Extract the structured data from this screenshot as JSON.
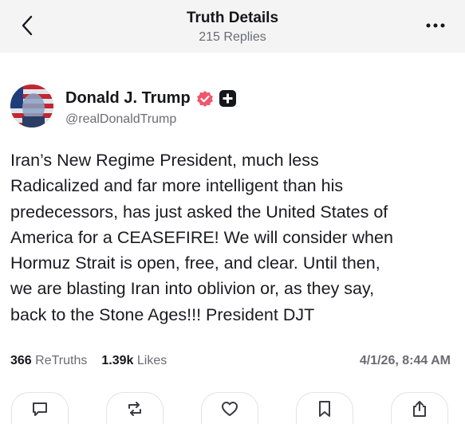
{
  "header": {
    "title": "Truth Details",
    "replies": "215 Replies"
  },
  "author": {
    "name": "Donald J. Trump",
    "handle": "@realDonaldTrump",
    "verified_color": "#f0566b"
  },
  "post": {
    "lines": [
      "Iran’s New Regime President, much less",
      "Radicalized and far more intelligent than his",
      "predecessors, has just asked the United States of",
      "America for a CEASEFIRE! We will consider when",
      "Hormuz Strait is open, free, and clear. Until then,",
      "we are blasting Iran into oblivion or, as they say,",
      "back to the Stone Ages!!! President DJT"
    ]
  },
  "stats": {
    "retruths_count": "366",
    "retruths_label": "ReTruths",
    "likes_count": "1.39k",
    "likes_label": "Likes",
    "timestamp": "4/1/26, 8:44 AM"
  },
  "actions": [
    {
      "name": "reply",
      "icon": "comment-icon"
    },
    {
      "name": "retruth",
      "icon": "repost-icon"
    },
    {
      "name": "like",
      "icon": "heart-icon"
    },
    {
      "name": "bookmark",
      "icon": "bookmark-icon"
    },
    {
      "name": "share",
      "icon": "share-icon"
    }
  ]
}
